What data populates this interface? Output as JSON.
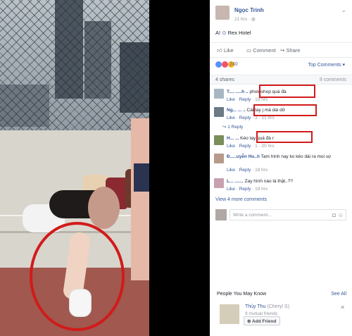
{
  "post": {
    "author": "Ngọc Trinh",
    "time": "21 hrs",
    "checkin_prefix": "A!",
    "location_icon": "pin-icon",
    "location": "Rex Hotel",
    "more_icon": "chevron-down-icon"
  },
  "actions": {
    "like": "Like",
    "comment": "Comment",
    "share": "Share"
  },
  "reactions": {
    "count": "240",
    "top_comments": "Top Comments ▾",
    "shares": "4 shares",
    "comments_count": "9 comments",
    "colors": {
      "like": "#5890ff",
      "love": "#f25268",
      "haha": "#f7b125"
    }
  },
  "comments": [
    {
      "author": "T.... .....h ..",
      "text": "photoshop quá đà",
      "meta_like": "Like",
      "meta_reply": "Reply",
      "meta_time": "19 hrs"
    },
    {
      "author": "Ng... ... ..",
      "text": "Cái tay j mà dài dữ",
      "meta_like": "Like",
      "meta_reply": "Reply",
      "meta_time": "3 · 21 hrs",
      "replies": "↪ 1 Reply"
    },
    {
      "author": "H... ...",
      "text": "Kéo tay quá đà r",
      "meta_like": "Like",
      "meta_reply": "Reply",
      "meta_time": "1 · 20 hrs"
    },
    {
      "author": "Đ.....uyễn Hu..h",
      "text": "Tam hình nay ko kéo dài ra moi sợ",
      "meta_like": "Like",
      "meta_reply": "Reply",
      "meta_time": "19 hrs"
    },
    {
      "author": "L... .......",
      "text": "Zay hình nào là thật..??",
      "meta_like": "Like",
      "meta_reply": "Reply",
      "meta_time": "19 hrs"
    }
  ],
  "view_more": "View 4 more comments",
  "composer": {
    "placeholder": "Write a comment...",
    "camera_icon": "camera-icon",
    "emoji_icon": "emoji-icon"
  },
  "pymk": {
    "title": "People You May Know",
    "see_all": "See All",
    "name": "Thủy Thu",
    "alt_name": "(Cheryl S)",
    "mutual": "9 mutual friends",
    "add_friend": "Add Friend",
    "close_icon": "close-icon"
  },
  "accent": "#d21a1a"
}
